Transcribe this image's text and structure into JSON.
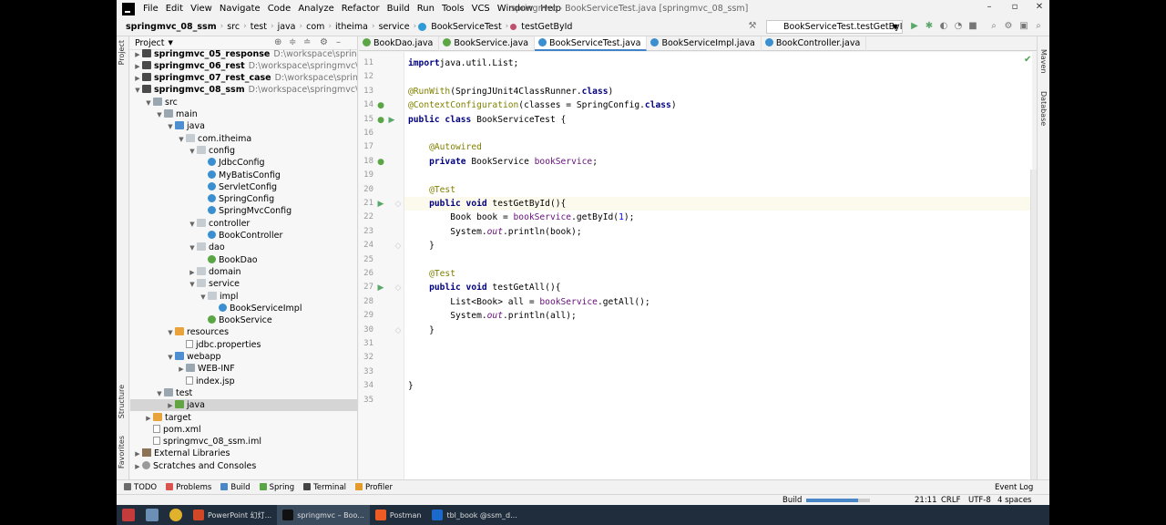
{
  "menubar": {
    "items": [
      "File",
      "Edit",
      "View",
      "Navigate",
      "Code",
      "Analyze",
      "Refactor",
      "Build",
      "Run",
      "Tools",
      "VCS",
      "Window",
      "Help"
    ],
    "title": "springmvc - BookServiceTest.java [springmvc_08_ssm]"
  },
  "navbar": {
    "crumbs": [
      "springmvc_08_ssm",
      "src",
      "test",
      "java",
      "com",
      "itheima",
      "service",
      "BookServiceTest",
      "testGetById"
    ],
    "run_config": "BookServiceTest.testGetById"
  },
  "stripes": {
    "project": "Project",
    "structure": "Structure",
    "favorites": "Favorites",
    "maven": "Maven",
    "database": "Database"
  },
  "project": {
    "header": "Project",
    "tree": [
      {
        "label": "springmvc_05_response",
        "path": "D:\\workspace\\springmvc\\springm",
        "bold": true,
        "depth": 0,
        "arrow": "right",
        "icon": "module"
      },
      {
        "label": "springmvc_06_rest",
        "path": "D:\\workspace\\springmvc\\springm",
        "bold": true,
        "depth": 0,
        "arrow": "right",
        "icon": "module"
      },
      {
        "label": "springmvc_07_rest_case",
        "path": "D:\\workspace\\springmvc\\springm",
        "bold": true,
        "depth": 0,
        "arrow": "right",
        "icon": "module"
      },
      {
        "label": "springmvc_08_ssm",
        "path": "D:\\workspace\\springmvc\\springm",
        "bold": true,
        "depth": 0,
        "arrow": "down",
        "icon": "module"
      },
      {
        "label": "src",
        "path": "",
        "bold": false,
        "depth": 1,
        "arrow": "down",
        "icon": "folder"
      },
      {
        "label": "main",
        "path": "",
        "bold": false,
        "depth": 2,
        "arrow": "down",
        "icon": "folder"
      },
      {
        "label": "java",
        "path": "",
        "bold": false,
        "depth": 3,
        "arrow": "down",
        "icon": "folder-blue"
      },
      {
        "label": "com.itheima",
        "path": "",
        "bold": false,
        "depth": 4,
        "arrow": "down",
        "icon": "pkg"
      },
      {
        "label": "config",
        "path": "",
        "bold": false,
        "depth": 5,
        "arrow": "down",
        "icon": "pkg"
      },
      {
        "label": "JdbcConfig",
        "path": "",
        "bold": false,
        "depth": 6,
        "arrow": "",
        "icon": "cls"
      },
      {
        "label": "MyBatisConfig",
        "path": "",
        "bold": false,
        "depth": 6,
        "arrow": "",
        "icon": "cls"
      },
      {
        "label": "ServletConfig",
        "path": "",
        "bold": false,
        "depth": 6,
        "arrow": "",
        "icon": "cls"
      },
      {
        "label": "SpringConfig",
        "path": "",
        "bold": false,
        "depth": 6,
        "arrow": "",
        "icon": "cls"
      },
      {
        "label": "SpringMvcConfig",
        "path": "",
        "bold": false,
        "depth": 6,
        "arrow": "",
        "icon": "cls"
      },
      {
        "label": "controller",
        "path": "",
        "bold": false,
        "depth": 5,
        "arrow": "down",
        "icon": "pkg"
      },
      {
        "label": "BookController",
        "path": "",
        "bold": false,
        "depth": 6,
        "arrow": "",
        "icon": "cls"
      },
      {
        "label": "dao",
        "path": "",
        "bold": false,
        "depth": 5,
        "arrow": "down",
        "icon": "pkg"
      },
      {
        "label": "BookDao",
        "path": "",
        "bold": false,
        "depth": 6,
        "arrow": "",
        "icon": "intf"
      },
      {
        "label": "domain",
        "path": "",
        "bold": false,
        "depth": 5,
        "arrow": "right",
        "icon": "pkg"
      },
      {
        "label": "service",
        "path": "",
        "bold": false,
        "depth": 5,
        "arrow": "down",
        "icon": "pkg"
      },
      {
        "label": "impl",
        "path": "",
        "bold": false,
        "depth": 6,
        "arrow": "down",
        "icon": "pkg"
      },
      {
        "label": "BookServiceImpl",
        "path": "",
        "bold": false,
        "depth": 7,
        "arrow": "",
        "icon": "cls"
      },
      {
        "label": "BookService",
        "path": "",
        "bold": false,
        "depth": 6,
        "arrow": "",
        "icon": "intf"
      },
      {
        "label": "resources",
        "path": "",
        "bold": false,
        "depth": 3,
        "arrow": "down",
        "icon": "folder-orange"
      },
      {
        "label": "jdbc.properties",
        "path": "",
        "bold": false,
        "depth": 4,
        "arrow": "",
        "icon": "file"
      },
      {
        "label": "webapp",
        "path": "",
        "bold": false,
        "depth": 3,
        "arrow": "down",
        "icon": "folder-blue"
      },
      {
        "label": "WEB-INF",
        "path": "",
        "bold": false,
        "depth": 4,
        "arrow": "right",
        "icon": "folder"
      },
      {
        "label": "index.jsp",
        "path": "",
        "bold": false,
        "depth": 4,
        "arrow": "",
        "icon": "file"
      },
      {
        "label": "test",
        "path": "",
        "bold": false,
        "depth": 2,
        "arrow": "down",
        "icon": "folder"
      },
      {
        "label": "java",
        "path": "",
        "bold": false,
        "depth": 3,
        "arrow": "right",
        "icon": "folder-green",
        "selected": true
      },
      {
        "label": "target",
        "path": "",
        "bold": false,
        "depth": 1,
        "arrow": "right",
        "icon": "folder-orange"
      },
      {
        "label": "pom.xml",
        "path": "",
        "bold": false,
        "depth": 1,
        "arrow": "",
        "icon": "file"
      },
      {
        "label": "springmvc_08_ssm.iml",
        "path": "",
        "bold": false,
        "depth": 1,
        "arrow": "",
        "icon": "file"
      },
      {
        "label": "External Libraries",
        "path": "",
        "bold": false,
        "depth": 0,
        "arrow": "right",
        "icon": "lib"
      },
      {
        "label": "Scratches and Consoles",
        "path": "",
        "bold": false,
        "depth": 0,
        "arrow": "right",
        "icon": "scratch"
      }
    ]
  },
  "tabs": [
    {
      "label": "BookDao.java",
      "color": "#5aa544",
      "active": false
    },
    {
      "label": "BookService.java",
      "color": "#5aa544",
      "active": false
    },
    {
      "label": "BookServiceTest.java",
      "color": "#3a8fd1",
      "active": true
    },
    {
      "label": "BookServiceImpl.java",
      "color": "#3a8fd1",
      "active": false
    },
    {
      "label": "BookController.java",
      "color": "#3a8fd1",
      "active": false
    }
  ],
  "editor": {
    "lines": [
      {
        "n": "11",
        "tokens": [
          [
            "kw",
            "import"
          ],
          [
            "",
            "java.util.List;"
          ]
        ]
      },
      {
        "n": "12",
        "tokens": []
      },
      {
        "n": "13",
        "tokens": [
          [
            "ann",
            "@RunWith"
          ],
          [
            "",
            "(SpringJUnit4ClassRunner."
          ],
          [
            "kw",
            "class"
          ],
          [
            "",
            ")"
          ]
        ]
      },
      {
        "n": "14",
        "tokens": [
          [
            "ann",
            "@ContextConfiguration"
          ],
          [
            "",
            "(classes = SpringConfig."
          ],
          [
            "kw",
            "class"
          ],
          [
            "",
            ")"
          ]
        ]
      },
      {
        "n": "15",
        "tokens": [
          [
            "kw",
            "public class "
          ],
          [
            "",
            "BookServiceTest {"
          ]
        ]
      },
      {
        "n": "16",
        "tokens": []
      },
      {
        "n": "17",
        "tokens": [
          [
            "",
            "    "
          ],
          [
            "ann",
            "@Autowired"
          ]
        ]
      },
      {
        "n": "18",
        "tokens": [
          [
            "",
            "    "
          ],
          [
            "kw",
            "private "
          ],
          [
            "",
            "BookService "
          ],
          [
            "fld",
            "bookService"
          ],
          [
            "",
            ";"
          ]
        ]
      },
      {
        "n": "19",
        "tokens": []
      },
      {
        "n": "20",
        "tokens": [
          [
            "",
            "    "
          ],
          [
            "ann",
            "@Test"
          ]
        ]
      },
      {
        "n": "21",
        "tokens": [
          [
            "",
            "    "
          ],
          [
            "kw",
            "public void "
          ],
          [
            "",
            "testGetById(){"
          ]
        ],
        "current": true
      },
      {
        "n": "22",
        "tokens": [
          [
            "",
            "        Book book = "
          ],
          [
            "fld",
            "bookService"
          ],
          [
            "",
            ".getById("
          ],
          [
            "num",
            "1"
          ],
          [
            "",
            ");"
          ]
        ]
      },
      {
        "n": "23",
        "tokens": [
          [
            "",
            "        System."
          ],
          [
            "sfld",
            "out"
          ],
          [
            "",
            ".println(book);"
          ]
        ]
      },
      {
        "n": "24",
        "tokens": [
          [
            "",
            "    }"
          ]
        ]
      },
      {
        "n": "25",
        "tokens": []
      },
      {
        "n": "26",
        "tokens": [
          [
            "",
            "    "
          ],
          [
            "ann",
            "@Test"
          ]
        ]
      },
      {
        "n": "27",
        "tokens": [
          [
            "",
            "    "
          ],
          [
            "kw",
            "public void "
          ],
          [
            "",
            "testGetAll(){"
          ]
        ]
      },
      {
        "n": "28",
        "tokens": [
          [
            "",
            "        List<Book> all = "
          ],
          [
            "fld",
            "bookService"
          ],
          [
            "",
            ".getAll();"
          ]
        ]
      },
      {
        "n": "29",
        "tokens": [
          [
            "",
            "        System."
          ],
          [
            "sfld",
            "out"
          ],
          [
            "",
            ".println(all);"
          ]
        ]
      },
      {
        "n": "30",
        "tokens": [
          [
            "",
            "    }"
          ]
        ]
      },
      {
        "n": "31",
        "tokens": []
      },
      {
        "n": "32",
        "tokens": []
      },
      {
        "n": "33",
        "tokens": []
      },
      {
        "n": "34",
        "tokens": [
          [
            "",
            "}"
          ]
        ]
      },
      {
        "n": "35",
        "tokens": []
      }
    ]
  },
  "bottombar": {
    "tools": [
      {
        "label": "TODO",
        "color": "#6a6a6a"
      },
      {
        "label": "Problems",
        "color": "#d9534f"
      },
      {
        "label": "Build",
        "color": "#4a87c7"
      },
      {
        "label": "Spring",
        "color": "#5aa544"
      },
      {
        "label": "Terminal",
        "color": "#444444"
      },
      {
        "label": "Profiler",
        "color": "#e39c2a"
      }
    ],
    "event_log": "Event Log"
  },
  "statusbar": {
    "build": "Build",
    "position": "21:11",
    "line_sep": "CRLF",
    "encoding": "UTF-8",
    "indent": "4 spaces"
  },
  "taskbar": {
    "items": [
      {
        "label": "PowerPoint 幻灯...",
        "color": "#d24726",
        "active": false
      },
      {
        "label": "springmvc – Boo...",
        "color": "#111111",
        "active": true
      },
      {
        "label": "Postman",
        "color": "#ef5b25",
        "active": false
      },
      {
        "label": "tbl_book @ssm_d...",
        "color": "#1b6ac9",
        "active": false
      }
    ]
  }
}
